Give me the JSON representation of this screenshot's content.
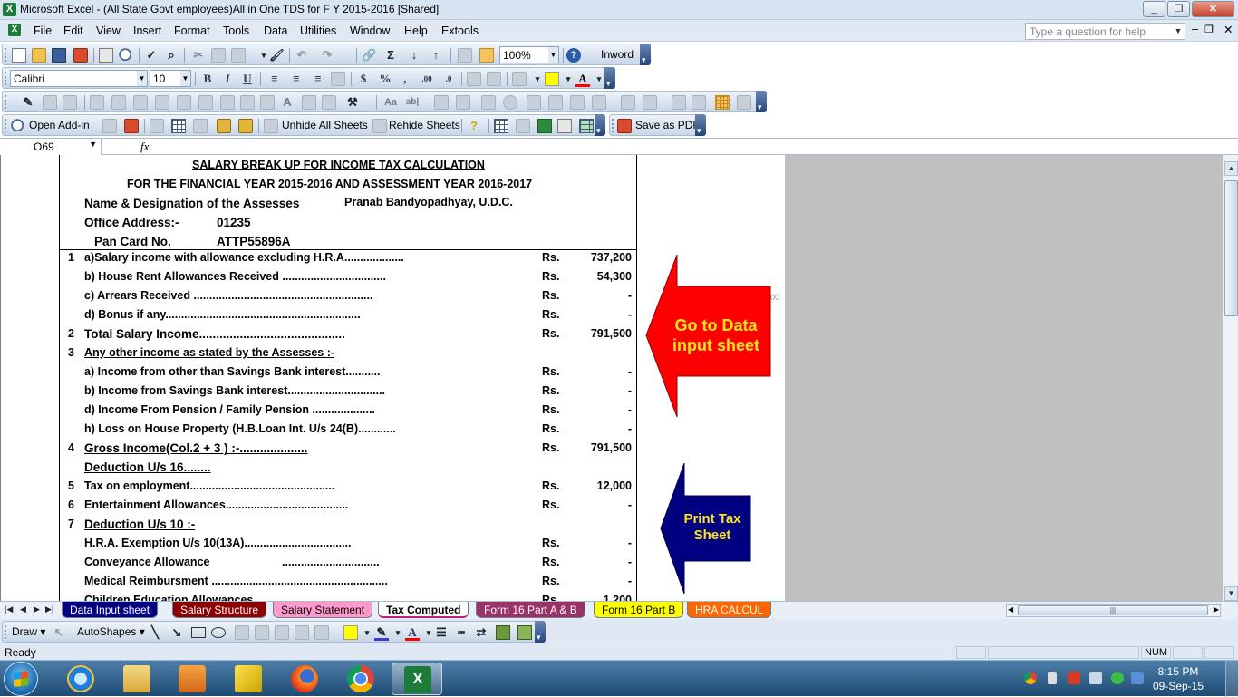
{
  "window": {
    "title": "Microsoft Excel - (All State Govt employees)All in One  TDS for  F Y 2015-2016  [Shared]",
    "controls": [
      "_",
      "❐",
      "✕"
    ]
  },
  "menu": {
    "items": [
      "File",
      "Edit",
      "View",
      "Insert",
      "Format",
      "Tools",
      "Data",
      "Utilities",
      "Window",
      "Help",
      "Extools"
    ],
    "help_placeholder": "Type a question for help",
    "doc_controls": [
      "–",
      "❐",
      "✕"
    ]
  },
  "toolbar_standard": {
    "zoom": "100%",
    "inword_label": "Inword"
  },
  "toolbar_format": {
    "font": "Calibri",
    "size": "10"
  },
  "toolbar_addin": {
    "open_addin": "Open Add-in",
    "unhide": "Unhide All Sheets",
    "rehide": "Rehide Sheets",
    "save_pdf": "Save as PDF"
  },
  "formula_bar": {
    "name_box": "O69",
    "fx": "fx",
    "content": ""
  },
  "sheet": {
    "heading1": "SALARY BREAK UP FOR INCOME TAX CALCULATION",
    "heading2": "FOR THE FINANCIAL YEAR 2015-2016 AND ASSESSMENT YEAR 2016-2017",
    "name_label": "Name & Designation of the Assesses",
    "name_value": "Pranab Bandyopadhyay, U.D.C.",
    "office_label": "Office Address:-",
    "office_value": "01235",
    "pan_label": "Pan Card No.",
    "pan_value": "ATTP55896A",
    "stray_text": "00",
    "rows": [
      {
        "no": "1",
        "desc": "a)Salary income with allowance excluding H.R.A...................",
        "rs": "Rs.",
        "amt": "737,200"
      },
      {
        "no": "",
        "desc": "b) House Rent Allowances Received .................................",
        "rs": "Rs.",
        "amt": "54,300"
      },
      {
        "no": "",
        "desc": "c) Arrears Received .........................................................",
        "rs": "Rs.",
        "amt": "-"
      },
      {
        "no": "",
        "desc": "d) Bonus if any..............................................................",
        "rs": "Rs.",
        "amt": "-"
      },
      {
        "no": "2",
        "desc": "Total Salary Income...........................................",
        "rs": "Rs.",
        "amt": "791,500"
      },
      {
        "no": "3",
        "desc": "Any other income as stated by the Assesses :-",
        "rs": "",
        "amt": ""
      },
      {
        "no": "",
        "desc": "a) Income from other than Savings Bank interest...........",
        "rs": "Rs.",
        "amt": "-"
      },
      {
        "no": "",
        "desc": "b) Income  from Savings Bank interest...............................",
        "rs": "Rs.",
        "amt": "-"
      },
      {
        "no": "",
        "desc": "d) Income From Pension / Family Pension ....................",
        "rs": "Rs.",
        "amt": "-"
      },
      {
        "no": "",
        "desc": "h) Loss on House Property (H.B.Loan Int. U/s 24(B)............",
        "rs": "Rs.",
        "amt": "-"
      },
      {
        "no": "4",
        "desc": "Gross Income(Col.2 + 3 ) :-....................",
        "rs": "Rs.",
        "amt": "791,500"
      },
      {
        "no": "",
        "desc": "Deduction U/s 16........",
        "rs": "",
        "amt": ""
      },
      {
        "no": "5",
        "desc": "Tax on employment..............................................",
        "rs": "Rs.",
        "amt": "12,000"
      },
      {
        "no": "6",
        "desc": "Entertainment Allowances.......................................",
        "rs": "Rs.",
        "amt": "-"
      },
      {
        "no": "7",
        "desc": "Deduction U/s 10 :-",
        "rs": "",
        "amt": ""
      },
      {
        "no": "",
        "desc": " H.R.A. Exemption U/s 10(13A)..................................",
        "rs": "Rs.",
        "amt": "-"
      },
      {
        "no": "",
        "desc": "Conveyance Allowance",
        "dots": "...............................",
        "rs": "Rs.",
        "amt": "-"
      },
      {
        "no": "",
        "desc": "Medical Reimbursment ........................................................",
        "rs": "Rs.",
        "amt": "-"
      },
      {
        "no": "",
        "desc": "Children Education Allowances",
        "rs": "Rs.",
        "amt": "1,200"
      }
    ],
    "arrow_go": "Go to Data input sheet",
    "arrow_print": "Print Tax Sheet",
    "arrow_go_color": "#ff0000",
    "arrow_print_color": "#000080",
    "arrow_text_color": "#ffe619"
  },
  "tabs": [
    {
      "label": "Data Input sheet",
      "color": "#000080",
      "text": "#ffffff"
    },
    {
      "label": "Salary Structure",
      "color": "#8b0000",
      "text": "#ffffff"
    },
    {
      "label": "Salary Statement",
      "color": "#ff99cc",
      "text": "#000000"
    },
    {
      "label": "Tax Computed",
      "color": "#ffffff",
      "text": "#000000"
    },
    {
      "label": "Form 16 Part A & B",
      "color": "#993366",
      "text": "#ffffff"
    },
    {
      "label": "Form 16 Part B",
      "color": "#ffff00",
      "text": "#000000"
    },
    {
      "label": "HRA CALCUL",
      "color": "#ff6600",
      "text": "#ffffff"
    }
  ],
  "drawbar": {
    "draw": "Draw",
    "autoshapes": "AutoShapes"
  },
  "status": {
    "ready": "Ready",
    "num": "NUM"
  },
  "taskbar": {
    "time": "8:15 PM",
    "date": "09-Sep-15"
  }
}
